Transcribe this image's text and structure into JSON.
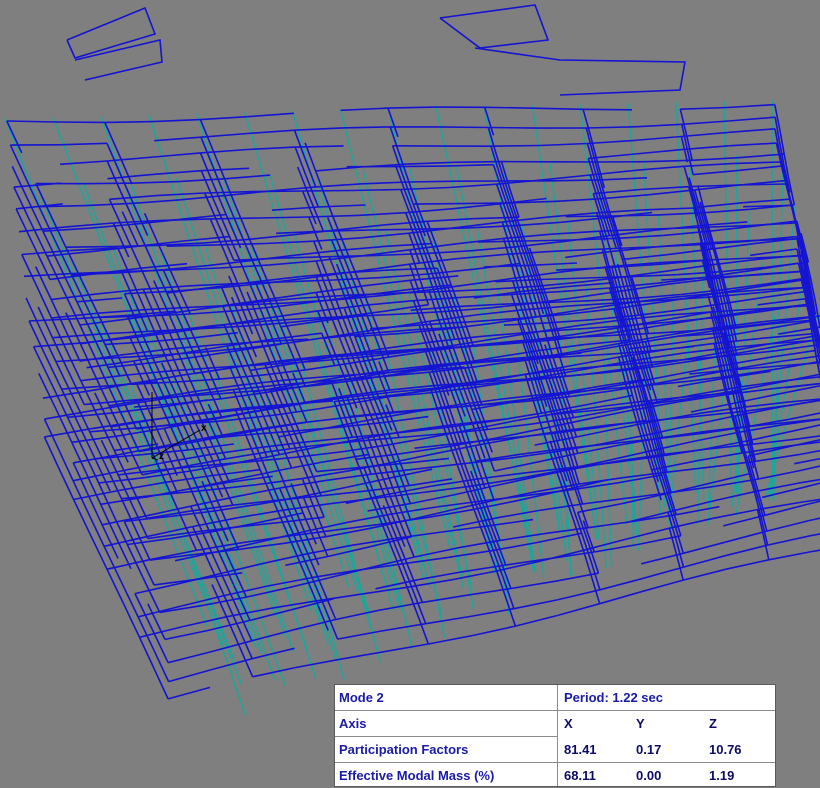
{
  "viewport": {
    "background_color": "#7f7f7f",
    "beam_color": "#1414d2",
    "column_color": "#1fa59a",
    "axis_labels": {
      "x": "x",
      "z": "z"
    }
  },
  "modal_table": {
    "mode_label": "Mode 2",
    "period_label": "Period: 1.22 sec",
    "axis_label": "Axis",
    "axes": [
      "X",
      "Y",
      "Z"
    ],
    "participation_label": "Participation Factors",
    "participation_values": [
      "81.41",
      "0.17",
      "10.76"
    ],
    "mass_label": "Effective Modal Mass (%)",
    "mass_values": [
      "68.11",
      "0.00",
      "1.19"
    ]
  }
}
